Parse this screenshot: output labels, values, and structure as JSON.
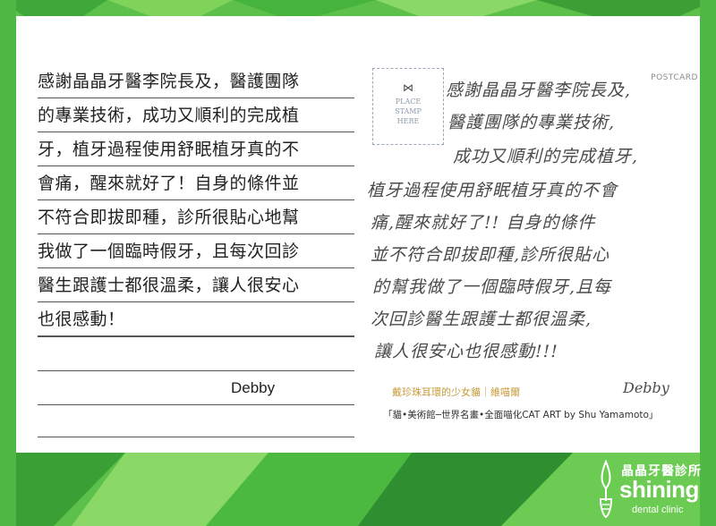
{
  "letter": {
    "lines": [
      "感謝晶晶牙醫李院長及，醫護團隊",
      "的專業技術，成功又順利的完成植",
      "牙，植牙過程使用舒眠植牙真的不",
      "會痛，醒來就好了！自身的條件並",
      "不符合即拔即種，診所很貼心地幫",
      "我做了一個臨時假牙，且每次回診",
      "醫生跟護士都很溫柔，讓人很安心",
      "也很感動！"
    ],
    "signature": "Debby"
  },
  "postcard": {
    "stamp_line1": "PLACE",
    "stamp_line2": "STAMP",
    "stamp_line3": "HERE",
    "label": "POSTCARD",
    "handwritten_lines": [
      "感謝晶晶牙醫李院長及,",
      "醫護團隊的專業技術,",
      "成功又順利的完成植牙,",
      "植牙過程使用舒眠植牙真的不會",
      "痛,醒來就好了!! 自身的條件",
      "並不符合即拔即種,診所很貼心",
      "的幫我做了一個臨時假牙,且每",
      "次回診醫生跟護士都很溫柔,",
      "讓人很安心也很感動!!!"
    ],
    "handwritten_signature": "Debby",
    "caption_title": "戴珍珠耳環的少女貓｜維喵爾",
    "caption_credit": "「貓•美術館─世界名畫•全面喵化CAT ART by Shu Yamamoto」"
  },
  "logo": {
    "name_zh": "晶晶牙醫診所",
    "name_en": "shining",
    "subtitle": "dental clinic"
  },
  "colors": {
    "background_green": "#5cc04a",
    "caption_gold": "#c79a3a"
  }
}
